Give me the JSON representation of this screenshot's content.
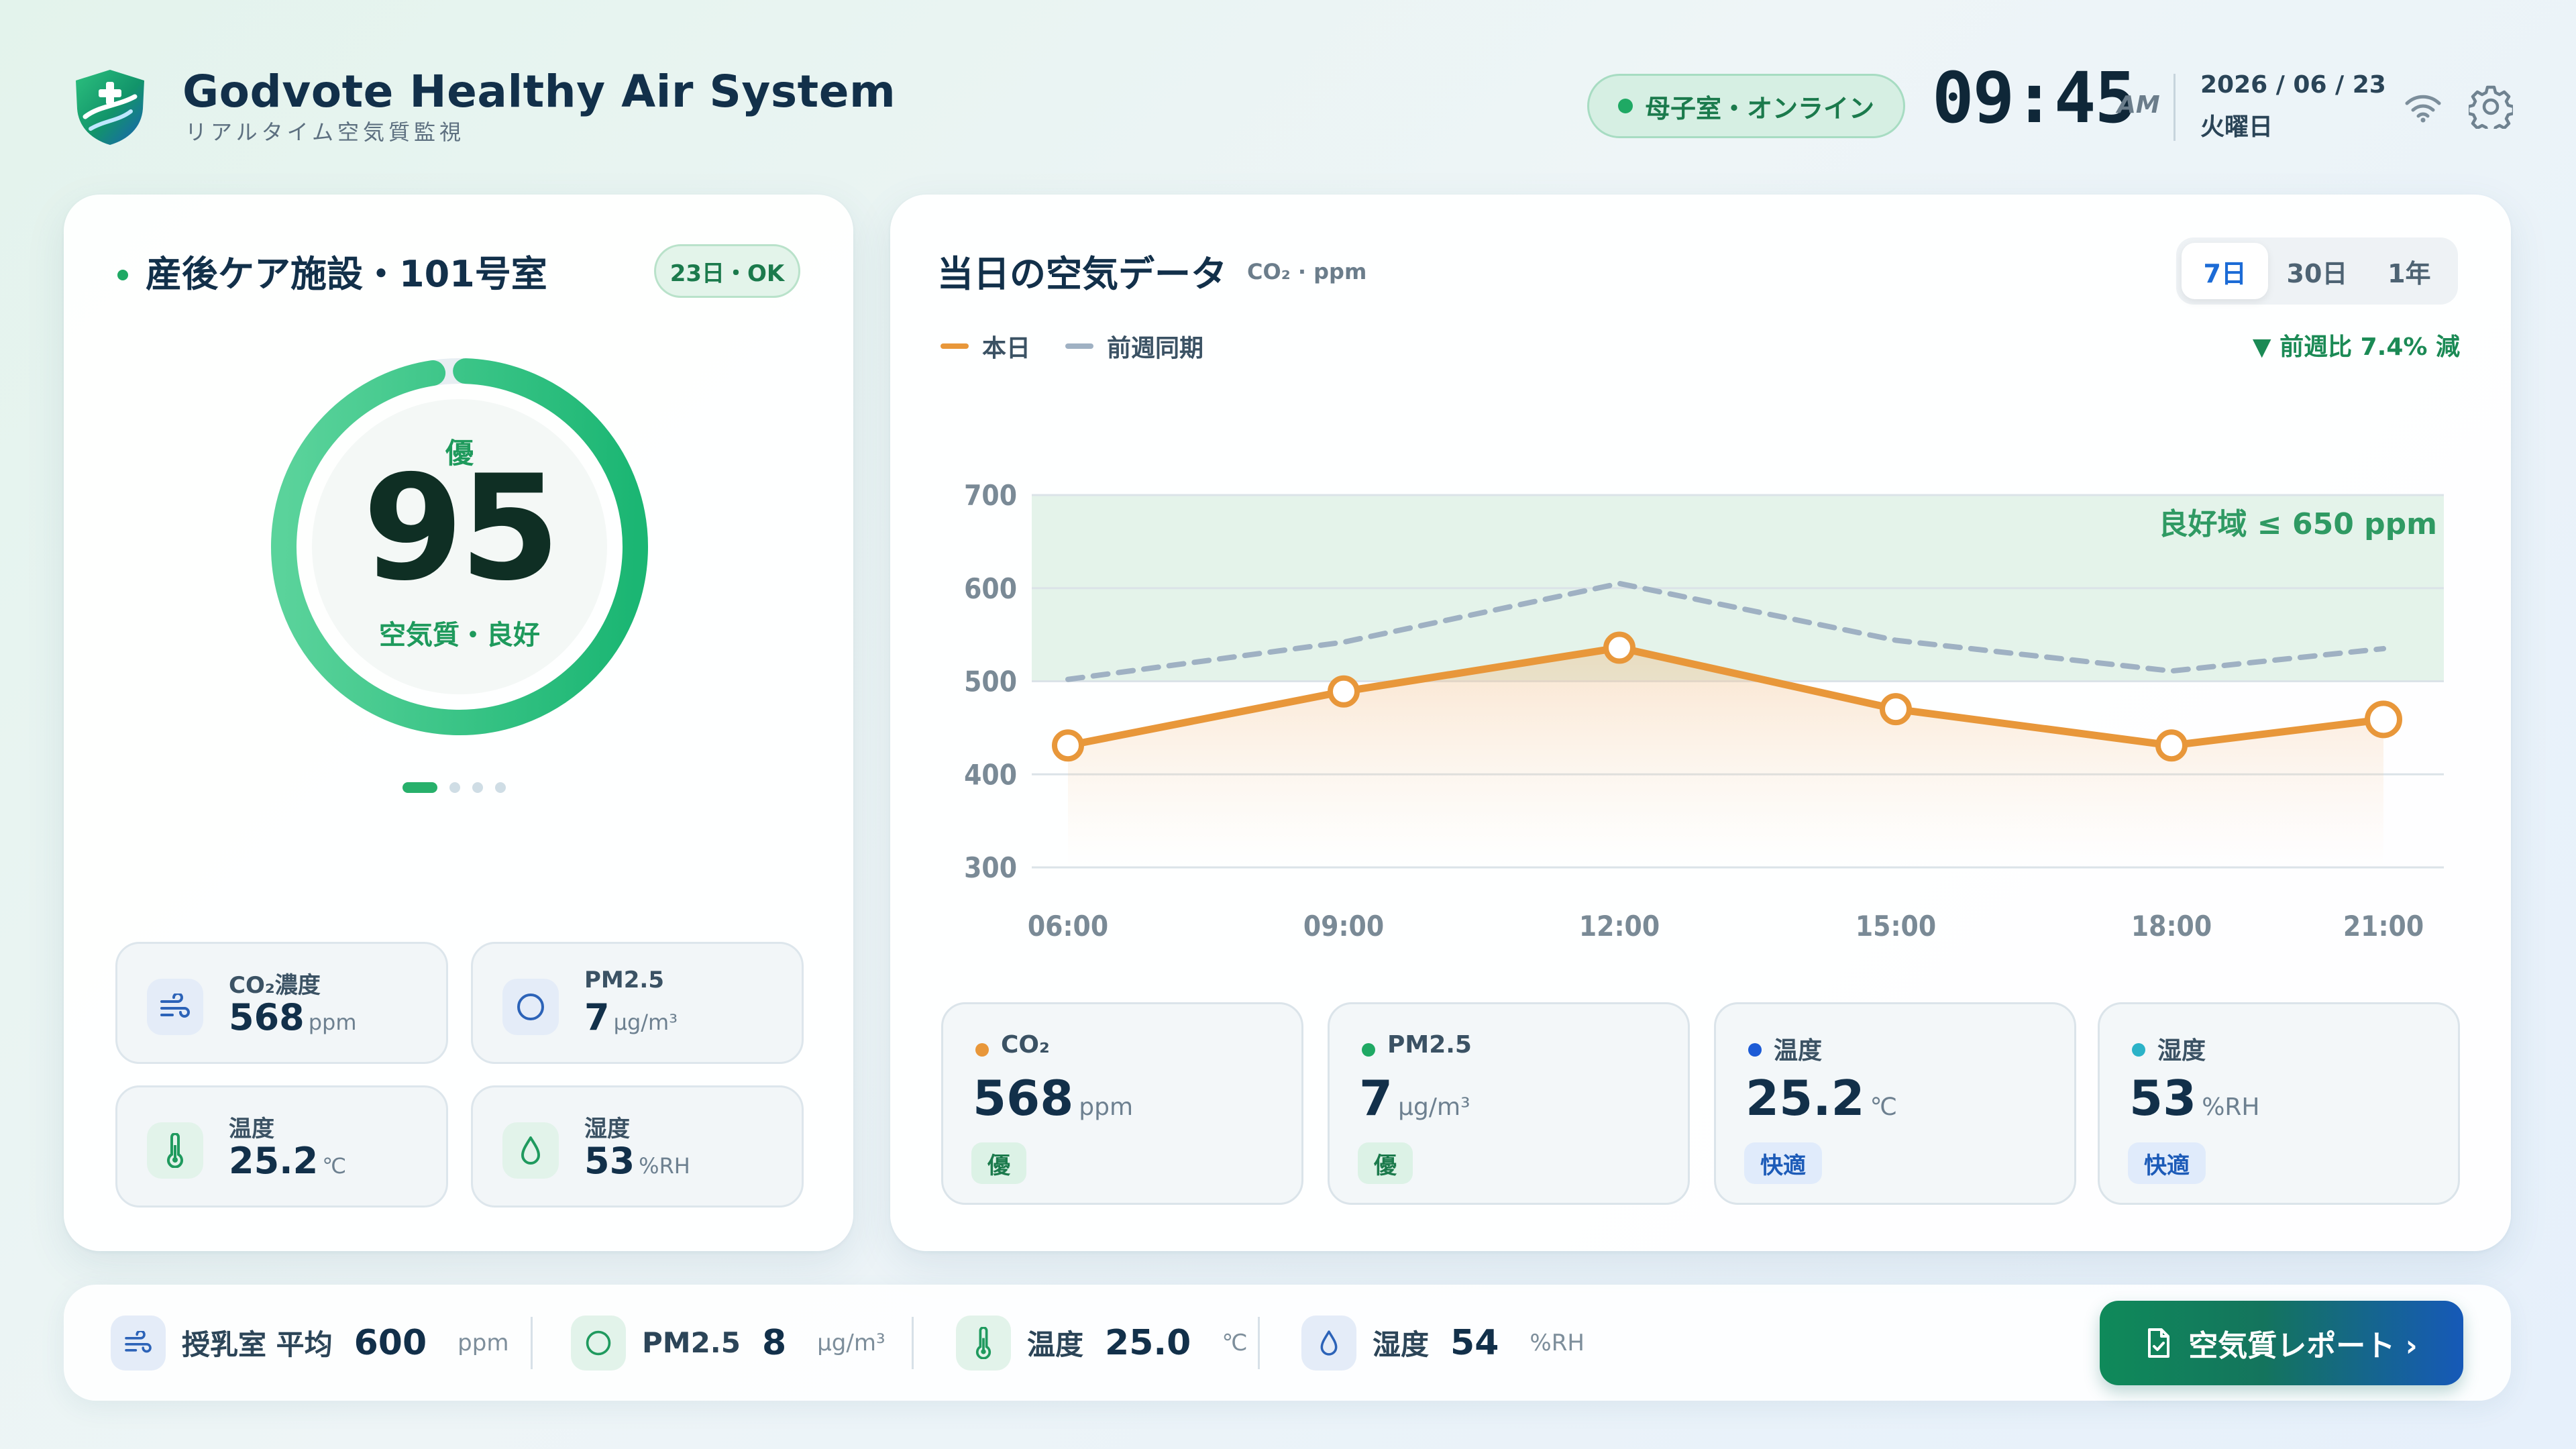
{
  "header": {
    "title": "Godvote Healthy Air System",
    "subtitle": "リアルタイム空気質監視",
    "status": "母子室・オンライン",
    "clock": "09:45",
    "ampm": "AM",
    "date": "2026 / 06 / 23",
    "weekday": "火曜日",
    "icons": [
      "shield-plus-logo",
      "wifi-icon",
      "gear-icon"
    ]
  },
  "room": {
    "title": "産後ケア施設・101号室",
    "badge": "23日・OK",
    "score": {
      "grade": "優",
      "value": "95",
      "label": "空気質・良好",
      "ring_fill_fraction": 0.97
    },
    "page_dots": {
      "count": 4,
      "active_index": 0
    },
    "metrics": [
      {
        "label": "CO₂濃度",
        "value": "568",
        "unit": "ppm",
        "icon": "wind-icon"
      },
      {
        "label": "PM2.5",
        "value": "7",
        "unit": "μg/m³",
        "icon": "circle-icon"
      },
      {
        "label": "温度",
        "value": "25.2",
        "unit": "℃",
        "icon": "thermometer-icon"
      },
      {
        "label": "湿度",
        "value": "53",
        "unit": "%RH",
        "icon": "droplet-icon"
      }
    ]
  },
  "chart_panel": {
    "title": "当日の空気データ",
    "unit": "CO₂ · ppm",
    "ranges": [
      "7日",
      "30日",
      "1年"
    ],
    "active_range": "7日",
    "legend": {
      "today": "本日",
      "last_week": "前週同期"
    },
    "delta": "▼ 前週比 7.4% 減",
    "cards": [
      {
        "label": "CO₂",
        "value": "568",
        "unit": "ppm",
        "badge": "優",
        "dot_color": "#e8973a",
        "badge_type": "good"
      },
      {
        "label": "PM2.5",
        "value": "7",
        "unit": "μg/m³",
        "badge": "優",
        "dot_color": "#1fa964",
        "badge_type": "good"
      },
      {
        "label": "温度",
        "value": "25.2",
        "unit": "℃",
        "badge": "快適",
        "dot_color": "#1c5bd6",
        "badge_type": "comfy"
      },
      {
        "label": "湿度",
        "value": "53",
        "unit": "%RH",
        "badge": "快適",
        "dot_color": "#2bb3c8",
        "badge_type": "comfy"
      }
    ]
  },
  "chart_data": {
    "type": "line",
    "x": [
      "06:00",
      "09:00",
      "12:00",
      "15:00",
      "18:00",
      "21:00"
    ],
    "series": [
      {
        "name": "本日",
        "values": [
          431,
          489,
          536,
          470,
          431,
          459
        ],
        "color": "#e8973a",
        "style": "solid"
      },
      {
        "name": "前週同期",
        "values": [
          502,
          542,
          605,
          544,
          511,
          535
        ],
        "color": "#9fb1c3",
        "style": "dashed"
      }
    ],
    "y_ticks": [
      700,
      600,
      500,
      400,
      300
    ],
    "ylim": [
      300,
      700
    ],
    "band": {
      "from": 500,
      "to": 700,
      "label": "良好域 ≤ 650 ppm",
      "color": "#e4f3ea"
    },
    "grid": true,
    "legend_position": "top-left"
  },
  "bottom_bar": {
    "stats": [
      {
        "label": "授乳室 平均",
        "value": "600",
        "unit": "ppm",
        "icon": "wind-icon"
      },
      {
        "label": "PM2.5",
        "value": "8",
        "unit": "μg/m³",
        "icon": "circle-icon"
      },
      {
        "label": "温度",
        "value": "25.0",
        "unit": "℃",
        "icon": "thermometer-icon"
      },
      {
        "label": "湿度",
        "value": "54",
        "unit": "%RH",
        "icon": "droplet-icon"
      }
    ],
    "report_button": "空気質レポート ›"
  },
  "colors": {
    "accent_green": "#1fa964",
    "accent_blue": "#1c6bd6",
    "today_line": "#e8973a",
    "last_week_line": "#9fb1c3"
  }
}
